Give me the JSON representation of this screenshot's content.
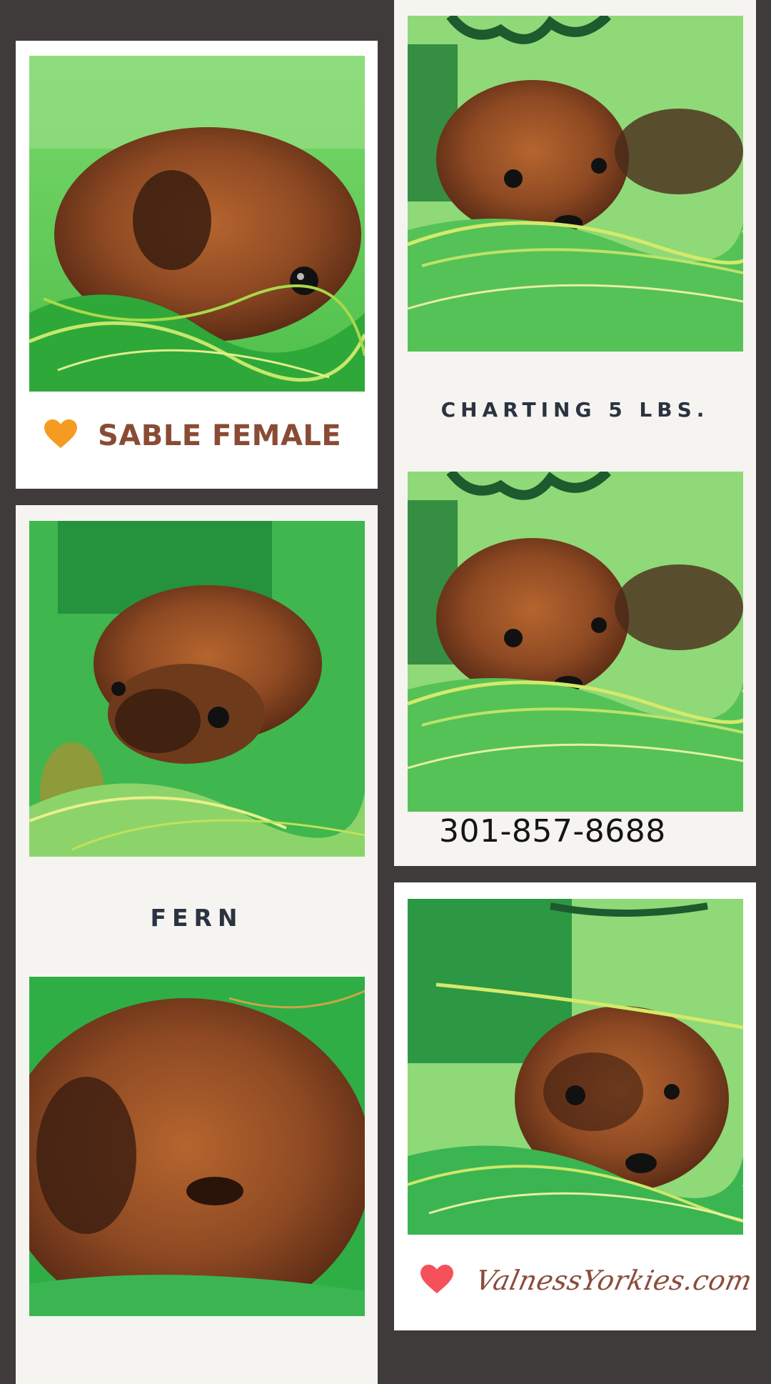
{
  "card_top_left": {
    "title": "SABLE FEMALE",
    "icon": "heart-icon",
    "icon_color": "#f59b23"
  },
  "card_mid_left": {
    "title": "FERN"
  },
  "card_top_right": {
    "title": "CHARTING 5 LBS.",
    "phone": "301-857-8688"
  },
  "card_bottom_right": {
    "website": "ValnessYorkies.com",
    "icon": "heart-icon",
    "icon_color": "#f4515a"
  },
  "colors": {
    "background": "#3f3b3a",
    "card_white": "#ffffff",
    "card_cream": "#f5f4f1",
    "accent_brown": "#8a4b34",
    "photo_green": "#7ccf5a"
  }
}
